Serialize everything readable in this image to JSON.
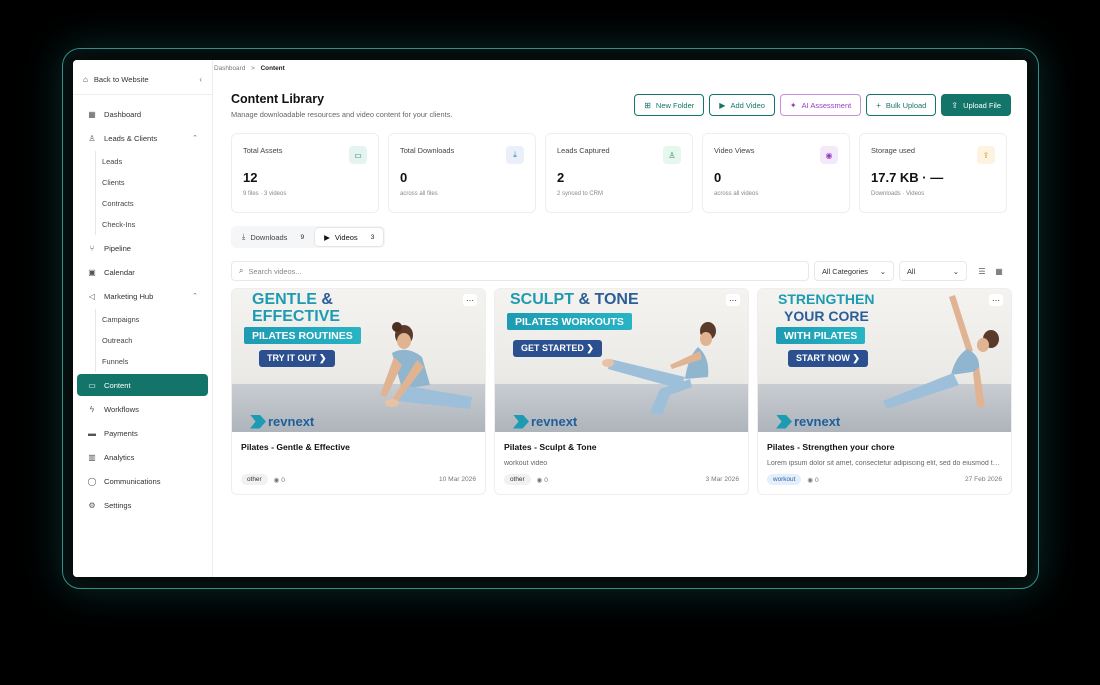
{
  "breadcrumb": {
    "root": "Dashboard",
    "sep": ">",
    "current": "Content"
  },
  "sidebar": {
    "back": "Back to Website",
    "items": [
      {
        "label": "Dashboard",
        "icon": "grid-icon"
      },
      {
        "label": "Leads & Clients",
        "icon": "users-icon",
        "expanded": true,
        "children": [
          "Leads",
          "Clients",
          "Contracts",
          "Check-Ins"
        ]
      },
      {
        "label": "Pipeline",
        "icon": "branch-icon"
      },
      {
        "label": "Calendar",
        "icon": "calendar-icon"
      },
      {
        "label": "Marketing Hub",
        "icon": "megaphone-icon",
        "expanded": true,
        "children": [
          "Campaigns",
          "Outreach",
          "Funnels"
        ]
      },
      {
        "label": "Content",
        "icon": "folder-icon",
        "active": true
      },
      {
        "label": "Workflows",
        "icon": "bolt-icon"
      },
      {
        "label": "Payments",
        "icon": "card-icon"
      },
      {
        "label": "Analytics",
        "icon": "chart-icon"
      },
      {
        "label": "Communications",
        "icon": "chat-icon"
      },
      {
        "label": "Settings",
        "icon": "gear-icon"
      }
    ]
  },
  "header": {
    "title": "Content Library",
    "subtitle": "Manage downloadable resources and video content for your clients."
  },
  "actions": {
    "new_folder": "New Folder",
    "add_video": "Add Video",
    "ai_assessment": "AI Assessment",
    "bulk_upload": "Bulk Upload",
    "upload_file": "Upload File"
  },
  "stats": [
    {
      "label": "Total Assets",
      "value": "12",
      "sub": "9 files · 3 videos",
      "icon": "folder-icon",
      "color": "#13756a",
      "bg": "#e6f4f1"
    },
    {
      "label": "Total Downloads",
      "value": "0",
      "sub": "across all files",
      "icon": "download-icon",
      "color": "#3a6fb5",
      "bg": "#e9f0fa"
    },
    {
      "label": "Leads Captured",
      "value": "2",
      "sub": "2 synced to CRM",
      "icon": "users-icon",
      "color": "#1f8f5e",
      "bg": "#e7f6ee"
    },
    {
      "label": "Video Views",
      "value": "0",
      "sub": "across all videos",
      "icon": "eye-icon",
      "color": "#9b3bc1",
      "bg": "#f4e9fa"
    },
    {
      "label": "Storage used",
      "value": "17.7 KB · —",
      "sub": "Downloads · Videos",
      "icon": "upload-icon",
      "color": "#d99a13",
      "bg": "#fcf3e0"
    }
  ],
  "tabs": [
    {
      "label": "Downloads",
      "count": "9"
    },
    {
      "label": "Videos",
      "count": "3"
    }
  ],
  "filters": {
    "search_placeholder": "Search videos...",
    "category": "All Categories",
    "type": "All"
  },
  "cards": [
    {
      "title": "Pilates - Gentle & Effective",
      "desc": "",
      "tag": "other",
      "views": "0",
      "date": "10 Mar 2026",
      "thumb": {
        "line1a": "GENTLE",
        "line1b": "&",
        "line2": "EFFECTIVE",
        "pill": "PILATES ROUTINES",
        "cta": "TRY IT OUT ❯",
        "brand": "revnext"
      }
    },
    {
      "title": "Pilates - Sculpt & Tone",
      "desc": "workout video",
      "tag": "other",
      "views": "0",
      "date": "3 Mar 2026",
      "thumb": {
        "line1a": "SCULPT",
        "line1b": "& TONE",
        "line2": "",
        "pill": "PILATES WORKOUTS",
        "cta": "GET STARTED ❯",
        "brand": "revnext"
      }
    },
    {
      "title": "Pilates - Strengthen your chore",
      "desc": "Lorem ipsum dolor sit amet, consectetur adipiscing elit, sed do eiusmod tempor",
      "tag": "workout",
      "views": "0",
      "date": "27 Feb 2026",
      "thumb": {
        "line1a": "STRENGTHEN",
        "line1b": "",
        "line2": "YOUR CORE",
        "pill": "WITH PILATES",
        "cta": "START NOW ❯",
        "brand": "revnext"
      }
    }
  ]
}
